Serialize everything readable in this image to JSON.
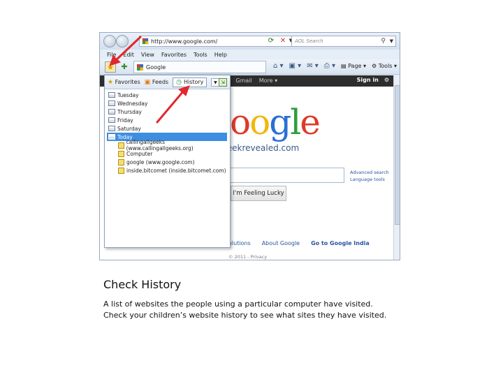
{
  "browser": {
    "url": "http://www.google.com/",
    "search_placeholder": "AOL Search",
    "menu": [
      "File",
      "Edit",
      "View",
      "Favorites",
      "Tools",
      "Help"
    ],
    "tab_label": "Google",
    "cmd_page": "Page",
    "cmd_tools": "Tools"
  },
  "favorites_pane": {
    "tab_favorites": "Favorites",
    "tab_feeds": "Feeds",
    "tab_history": "History",
    "days": [
      "Tuesday",
      "Wednesday",
      "Thursday",
      "Friday",
      "Saturday",
      "Today"
    ],
    "selected_day": "Today",
    "sites": [
      "callingallgeeks (www.callingallgeeks.org)",
      "Computer",
      "google (www.google.com)",
      "inside.bitcomet (inside.bitcomet.com)"
    ]
  },
  "google_page": {
    "bar_links": [
      "ing",
      "Gmail",
      "More ▾"
    ],
    "sign_in": "Sign in",
    "logo": [
      "o",
      "o",
      "g",
      "l",
      "e"
    ],
    "watermark": "www.geekrevealed.com",
    "advanced_search": "Advanced search",
    "language_tools": "Language tools",
    "lucky_button": "I'm Feeling Lucky",
    "footer_links": [
      "olutions",
      "About Google",
      "Go to Google India"
    ],
    "copyright": "© 2011 - Privacy"
  },
  "caption": {
    "title": "Check History",
    "line1": "A list of websites the people using a particular computer have visited.",
    "line2": "Check your children’s website history to see what sites they have visited."
  },
  "colors": {
    "annotation_arrow": "#e0282e",
    "selection": "#3d8ee0"
  }
}
